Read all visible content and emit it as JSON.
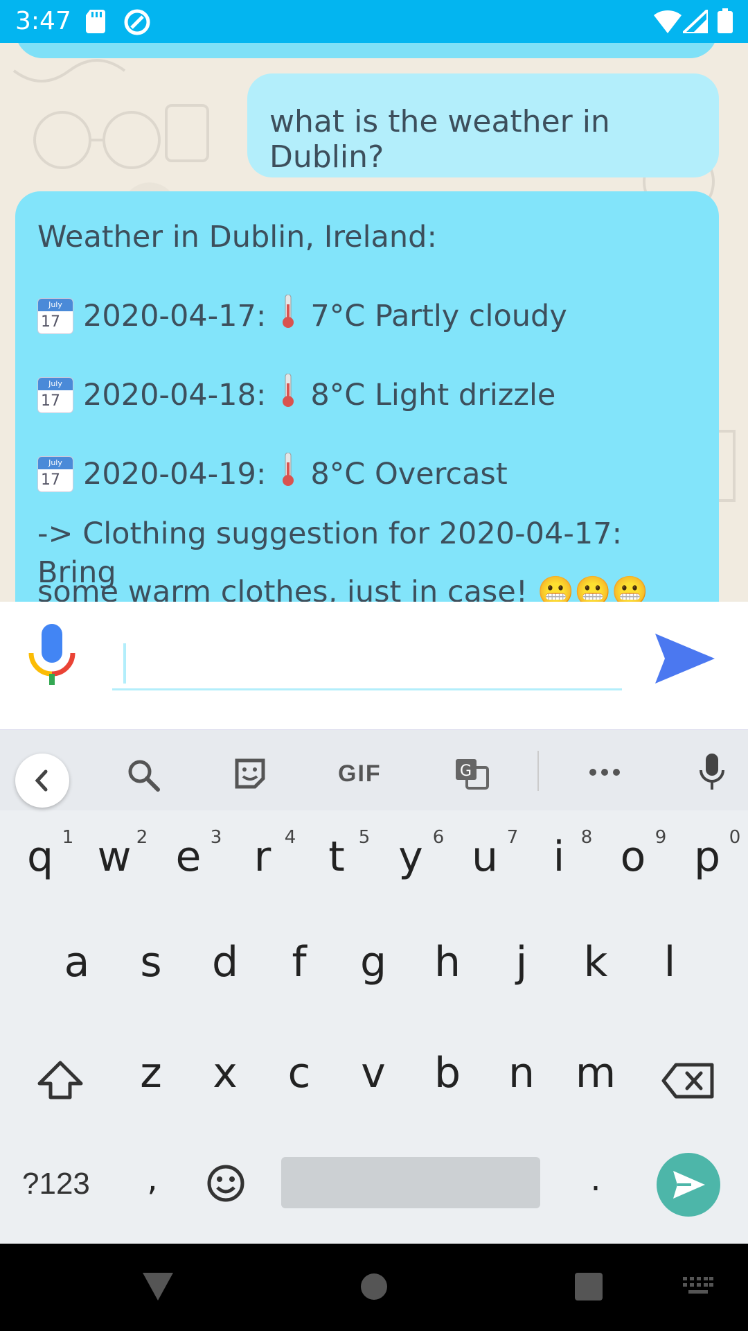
{
  "status_bar": {
    "time": "3:47",
    "accent": "#03b5f0"
  },
  "chat": {
    "user_message": "what is the weather in Dublin?",
    "bot_message": {
      "title": "Weather in Dublin, Ireland:",
      "calendar_month": "July",
      "calendar_day": "17",
      "forecast": [
        {
          "date": "2020-04-17:",
          "detail": "7°C Partly cloudy"
        },
        {
          "date": "2020-04-18:",
          "detail": "8°C Light drizzle"
        },
        {
          "date": "2020-04-19:",
          "detail": "8°C Overcast"
        }
      ],
      "suggestion_line1": "-> Clothing suggestion for 2020-04-17: Bring",
      "suggestion_line2": "some warm clothes, just in case! 😬😬😬"
    },
    "colors": {
      "user_bubble": "#b3eefb",
      "bot_bubble": "#82e4fa"
    }
  },
  "input": {
    "value": "",
    "placeholder": ""
  },
  "keyboard": {
    "toolbar": {
      "gif_label": "GIF"
    },
    "row1": [
      "q",
      "w",
      "e",
      "r",
      "t",
      "y",
      "u",
      "i",
      "o",
      "p"
    ],
    "row1_hints": [
      "1",
      "2",
      "3",
      "4",
      "5",
      "6",
      "7",
      "8",
      "9",
      "0"
    ],
    "row2": [
      "a",
      "s",
      "d",
      "f",
      "g",
      "h",
      "j",
      "k",
      "l"
    ],
    "row3": [
      "z",
      "x",
      "c",
      "v",
      "b",
      "n",
      "m"
    ],
    "symbols_label": "?123",
    "comma": ",",
    "period": ".",
    "enter_color": "#4db6a9"
  }
}
